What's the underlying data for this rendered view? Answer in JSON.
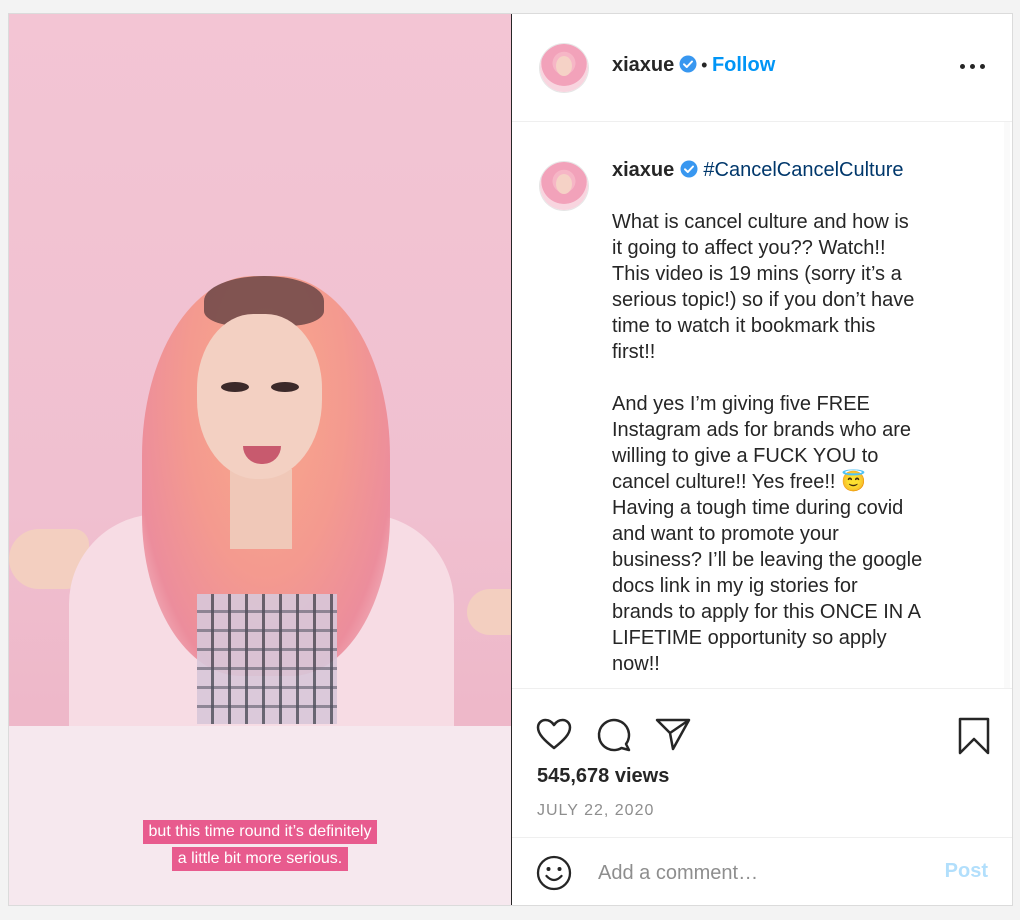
{
  "header": {
    "username": "xiaxue",
    "separator": "•",
    "follow_label": "Follow"
  },
  "caption": {
    "username": "xiaxue",
    "hashtag": "#CancelCancelCulture",
    "text": "What is cancel culture and how is\nit going to affect you?? Watch!!\nThis video is 19 mins (sorry it’s a\nserious topic!) so if you don’t have\ntime to watch it bookmark this\nfirst!!\n\nAnd yes I’m giving five FREE\nInstagram ads for brands who are\nwilling to give a FUCK YOU to\ncancel culture!! Yes free!! 😇\nHaving a tough time during covid\nand want to promote your\nbusiness? I’ll be leaving the google\ndocs link in my ig stories for\nbrands to apply for this ONCE IN A\nLIFETIME opportunity so apply\nnow!!"
  },
  "video": {
    "subtitle_line1": "but this time round it’s definitely",
    "subtitle_line2": "a little bit more serious."
  },
  "stats": {
    "views": "545,678 views",
    "date": "JULY 22, 2020"
  },
  "comment_box": {
    "placeholder": "Add a comment…",
    "post_label": "Post"
  },
  "icons": [
    "verified-badge-icon",
    "more-options-icon",
    "heart-icon",
    "comment-icon",
    "share-icon",
    "bookmark-icon",
    "emoji-icon"
  ],
  "colors": {
    "follow": "#0095f6",
    "hashtag": "#00376b",
    "post_disabled": "#b2dffc",
    "subtitle_bg": "#e85b8e",
    "verified": "#3897f0"
  }
}
